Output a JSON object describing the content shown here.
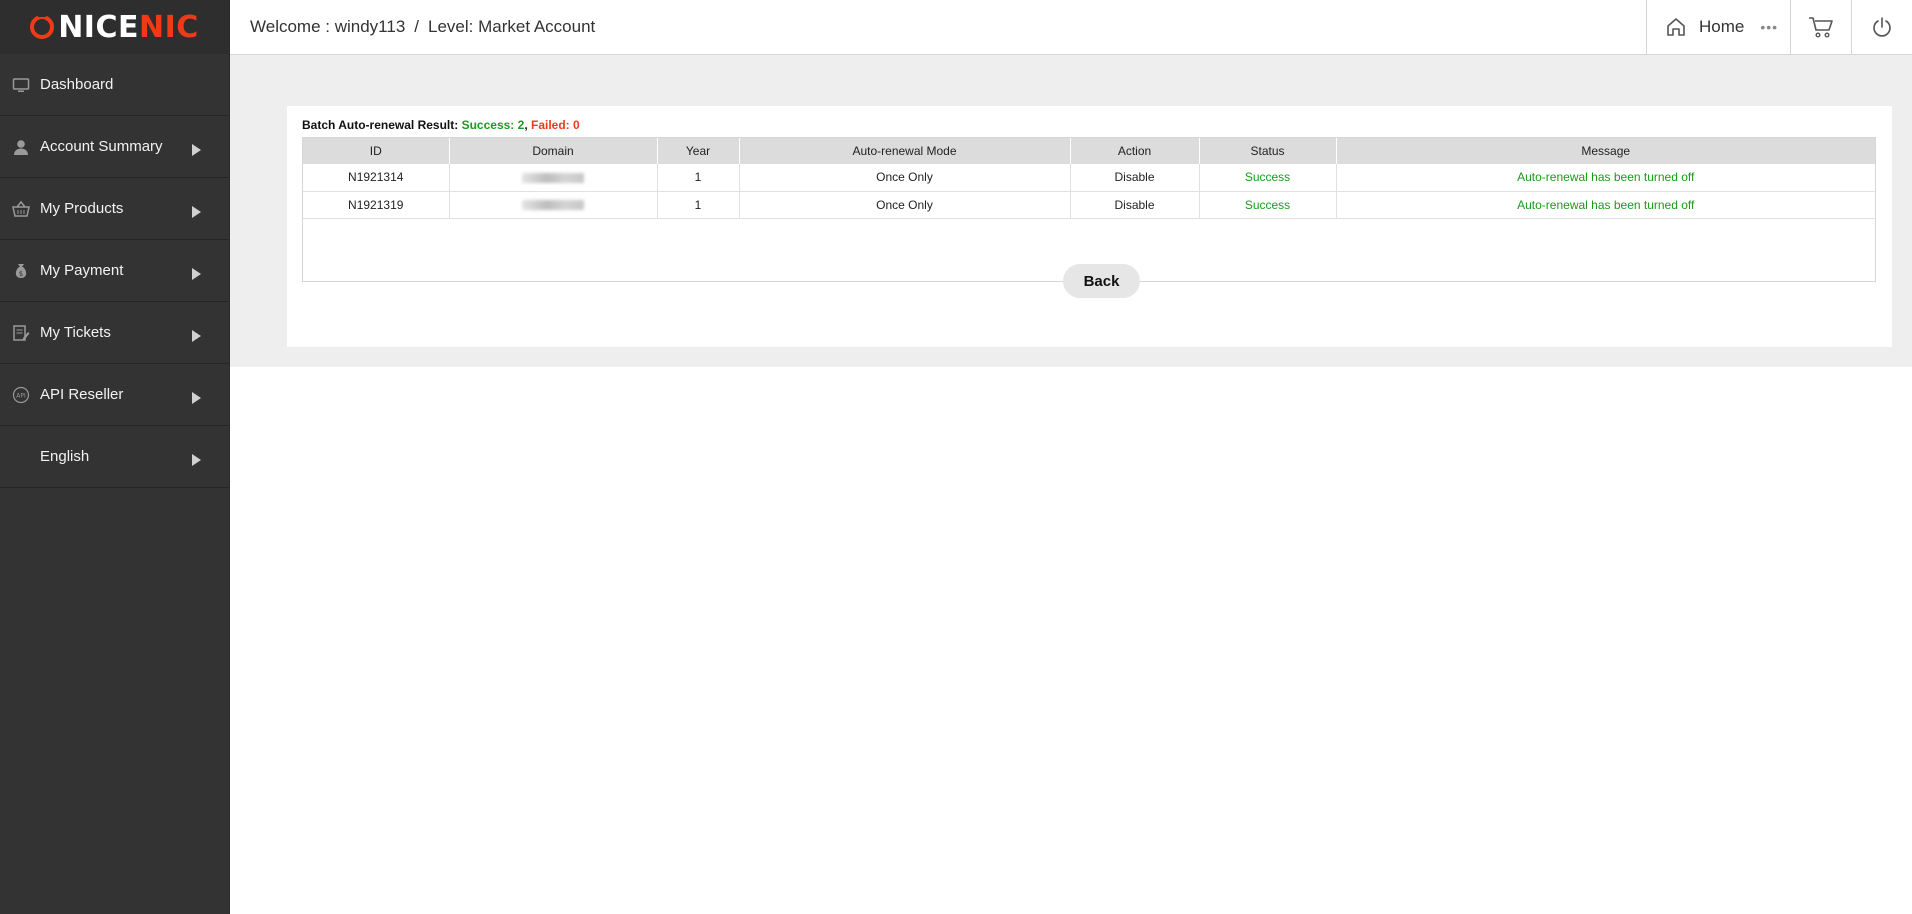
{
  "brand": {
    "logo_text_white": "NICE",
    "logo_text_red": "NIC",
    "accent": "#f03a17"
  },
  "header": {
    "welcome_label": "Welcome : windy113",
    "separator": "/",
    "level_label": "Level: Market Account",
    "home_label": "Home",
    "more_label": "•••"
  },
  "sidebar": {
    "items": [
      {
        "label": "Dashboard",
        "icon": "monitor-icon"
      },
      {
        "label": "Account Summary",
        "icon": "user-icon"
      },
      {
        "label": "My Products",
        "icon": "basket-icon"
      },
      {
        "label": "My Payment",
        "icon": "money-bag-icon"
      },
      {
        "label": "My Tickets",
        "icon": "ticket-edit-icon"
      },
      {
        "label": "API Reseller",
        "icon": "api-icon"
      },
      {
        "label": "English",
        "icon": ""
      }
    ]
  },
  "result": {
    "title": "Batch Auto-renewal Result:",
    "success_label": "Success: 2",
    "comma": ",",
    "failed_label": "Failed: 0",
    "success_color": "#1a9b1a",
    "failed_color": "#f03a17"
  },
  "table": {
    "headers": [
      "ID",
      "Domain",
      "Year",
      "Auto-renewal Mode",
      "Action",
      "Status",
      "Message"
    ],
    "rows": [
      {
        "id": "N1921314",
        "year": "1",
        "mode": "Once Only",
        "action": "Disable",
        "status": "Success",
        "message": "Auto-renewal has been turned off"
      },
      {
        "id": "N1921319",
        "year": "1",
        "mode": "Once Only",
        "action": "Disable",
        "status": "Success",
        "message": "Auto-renewal has been turned off"
      }
    ]
  },
  "back_label": "Back"
}
